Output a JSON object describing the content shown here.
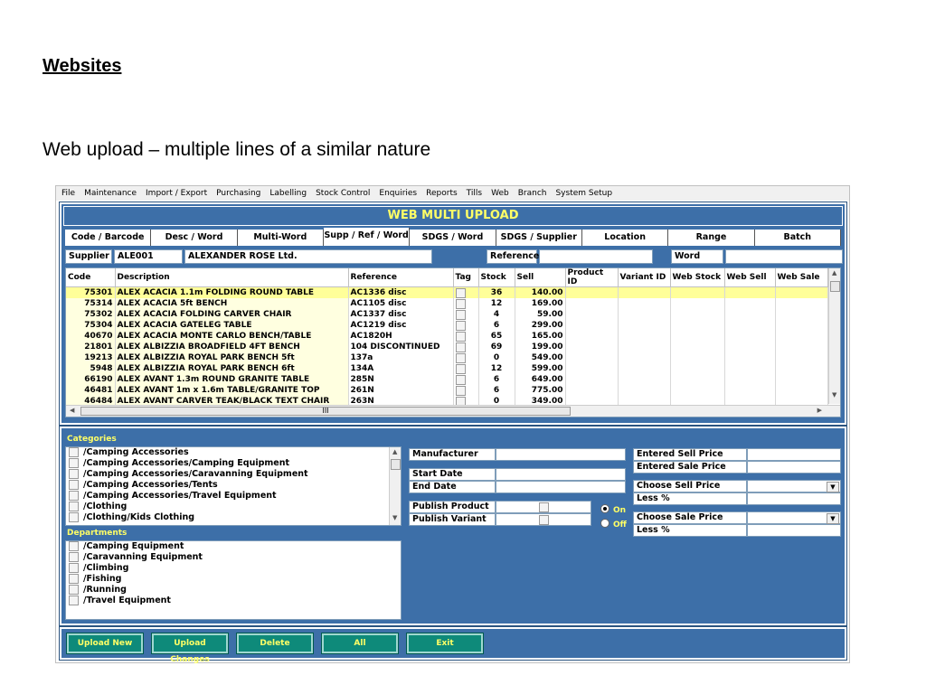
{
  "slide": {
    "title": "Websites",
    "subtitle": "Web upload – multiple lines of a similar nature"
  },
  "menu": [
    "File",
    "Maintenance",
    "Import / Export",
    "Purchasing",
    "Labelling",
    "Stock Control",
    "Enquiries",
    "Reports",
    "Tills",
    "Web",
    "Branch",
    "System Setup"
  ],
  "window_title": "WEB MULTI UPLOAD",
  "tabs": [
    "Code / Barcode",
    "Desc / Word",
    "Multi-Word",
    "Supp / Ref / Word",
    "SDGS / Word",
    "SDGS / Supplier",
    "Location",
    "Range",
    "Batch"
  ],
  "active_tab": "Supp / Ref / Word",
  "search": {
    "supplier_label": "Supplier",
    "supplier_code": "ALE001",
    "supplier_name": "ALEXANDER ROSE Ltd.",
    "reference_label": "Reference",
    "reference_value": "",
    "word_label": "Word",
    "word_value": ""
  },
  "grid": {
    "columns": [
      "Code",
      "Description",
      "Reference",
      "Tag",
      "Stock",
      "Sell",
      "Product ID",
      "Variant ID",
      "Web Stock",
      "Web Sell",
      "Web Sale"
    ],
    "rows": [
      {
        "code": "75301",
        "description": "ALEX ACACIA 1.1m FOLDING ROUND TABLE",
        "reference": "AC1336 disc",
        "stock": "36",
        "sell": "140.00"
      },
      {
        "code": "75314",
        "description": "ALEX ACACIA 5ft BENCH",
        "reference": "AC1105 disc",
        "stock": "12",
        "sell": "169.00"
      },
      {
        "code": "75302",
        "description": "ALEX ACACIA FOLDING CARVER CHAIR",
        "reference": "AC1337 disc",
        "stock": "4",
        "sell": "59.00"
      },
      {
        "code": "75304",
        "description": "ALEX ACACIA GATELEG TABLE",
        "reference": "AC1219 disc",
        "stock": "6",
        "sell": "299.00"
      },
      {
        "code": "40670",
        "description": "ALEX ACACIA MONTE CARLO BENCH/TABLE",
        "reference": "AC1820H",
        "stock": "65",
        "sell": "165.00"
      },
      {
        "code": "21801",
        "description": "ALEX ALBIZZIA BROADFIELD 4FT BENCH",
        "reference": "104 DISCONTINUED",
        "stock": "69",
        "sell": "199.00"
      },
      {
        "code": "19213",
        "description": "ALEX ALBIZZIA ROYAL PARK BENCH 5ft",
        "reference": "137a",
        "stock": "0",
        "sell": "549.00"
      },
      {
        "code": "5948",
        "description": "ALEX ALBIZZIA ROYAL PARK BENCH 6ft",
        "reference": "134A",
        "stock": "12",
        "sell": "599.00"
      },
      {
        "code": "66190",
        "description": "ALEX AVANT 1.3m ROUND GRANITE TABLE",
        "reference": "285N",
        "stock": "6",
        "sell": "649.00"
      },
      {
        "code": "46481",
        "description": "ALEX AVANT 1m x 1.6m TABLE/GRANITE TOP",
        "reference": "261N",
        "stock": "6",
        "sell": "775.00"
      },
      {
        "code": "46484",
        "description": "ALEX AVANT CARVER TEAK/BLACK TEXT CHAIR",
        "reference": "263N",
        "stock": "0",
        "sell": "349.00"
      }
    ],
    "hscroll_grip": "III"
  },
  "categories": {
    "label": "Categories",
    "items": [
      "/Camping Accessories",
      "/Camping Accessories/Camping Equipment",
      "/Camping Accessories/Caravanning Equipment",
      "/Camping Accessories/Tents",
      "/Camping Accessories/Travel Equipment",
      "/Clothing",
      "/Clothing/Kids Clothing"
    ]
  },
  "departments": {
    "label": "Departments",
    "items": [
      "/Camping Equipment",
      "/Caravanning Equipment",
      "/Climbing",
      "/Fishing",
      "/Running",
      "/Travel Equipment"
    ]
  },
  "fields": {
    "manufacturer": "Manufacturer",
    "start_date": "Start Date",
    "end_date": "End Date",
    "publish_product": "Publish Product",
    "publish_variant": "Publish Variant",
    "on": "On",
    "off": "Off",
    "entered_sell_price": "Entered Sell Price",
    "entered_sale_price": "Entered Sale Price",
    "choose_sell_price": "Choose Sell Price",
    "less_pct_1": "Less %",
    "choose_sale_price": "Choose Sale Price",
    "less_pct_2": "Less %"
  },
  "buttons": [
    "Upload New",
    "Upload Changes",
    "Delete",
    "All",
    "Exit"
  ],
  "colors": {
    "panel_blue": "#3d6fa8",
    "title_yellow": "#ffff66",
    "selected_row": "#ffff99",
    "button_teal": "#0e8a7a"
  }
}
